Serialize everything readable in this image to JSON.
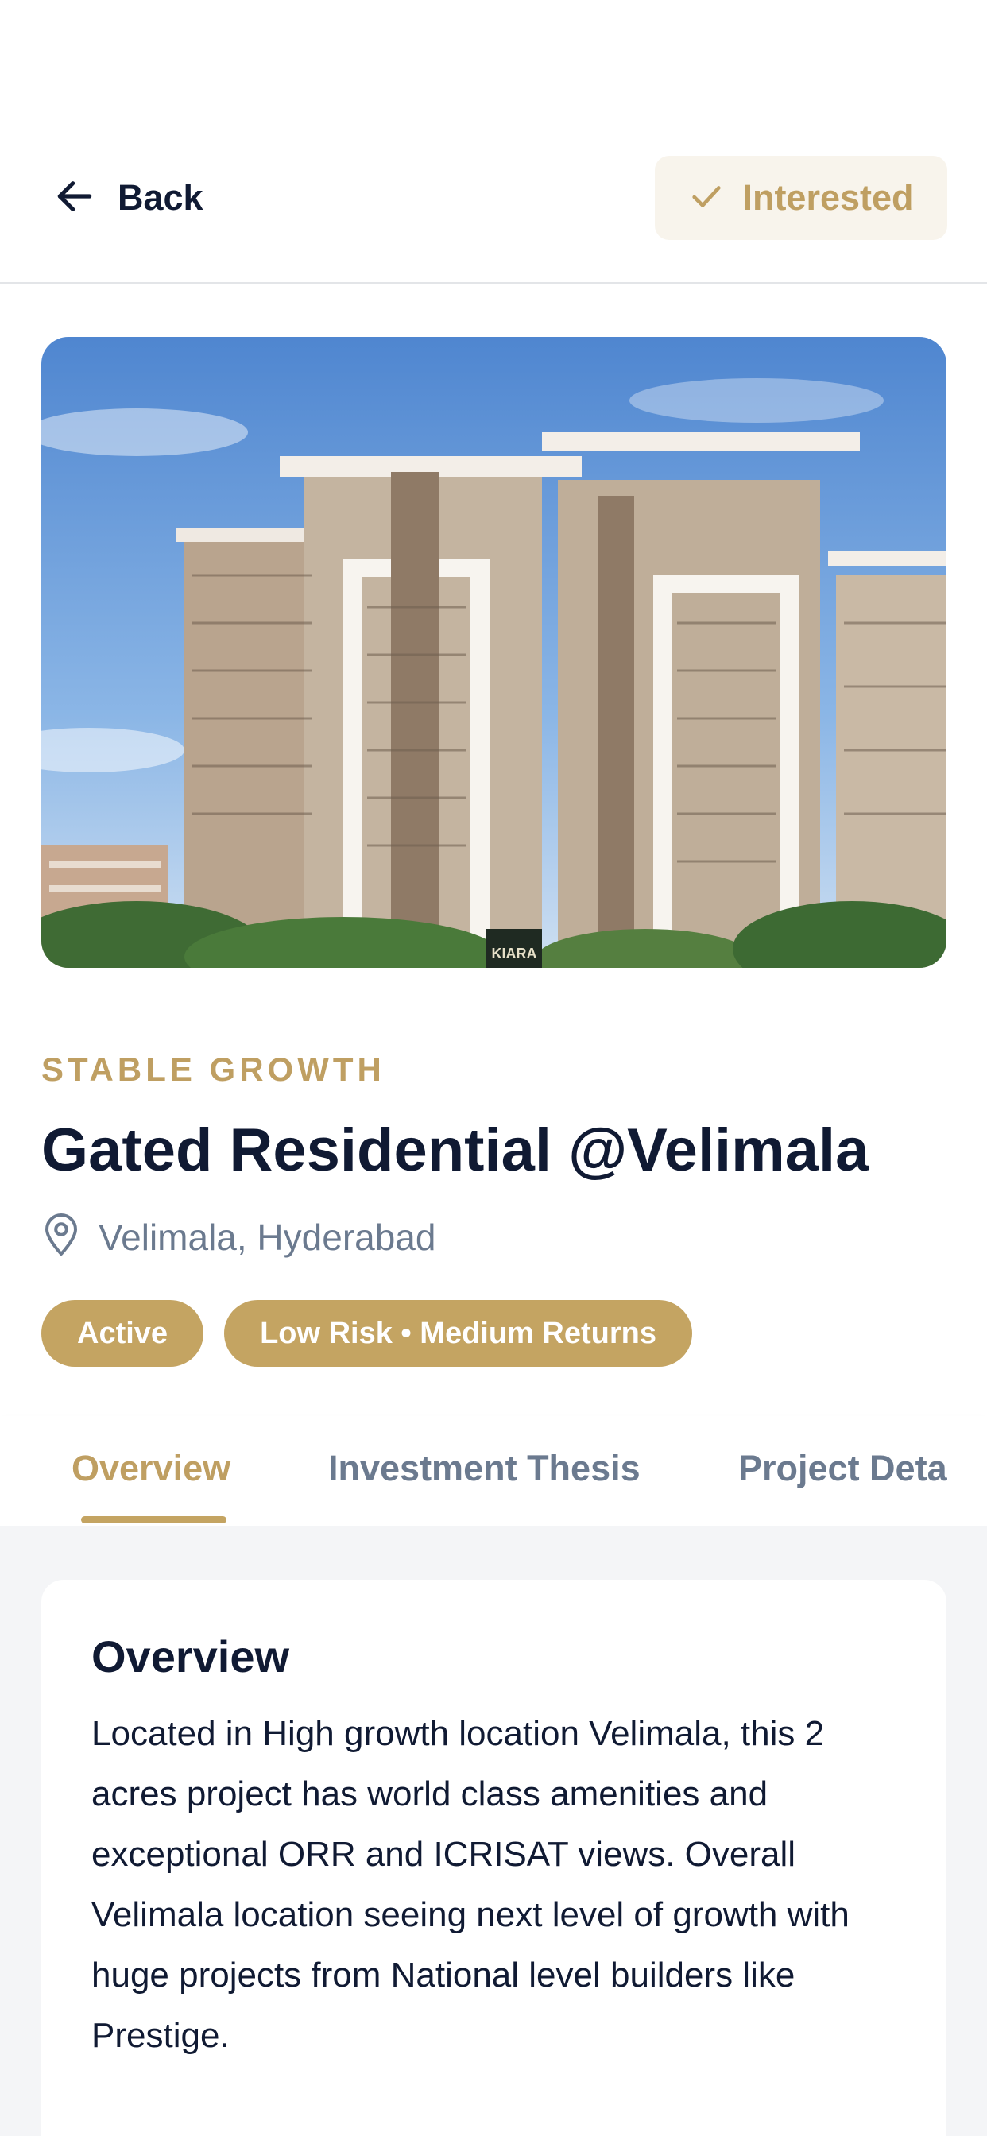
{
  "header": {
    "back_label": "Back",
    "interested_label": "Interested",
    "back_icon": "arrow-left-icon",
    "interested_icon": "check-icon"
  },
  "hero": {
    "image_description_icon": "building-image",
    "sign_text": "KIARA"
  },
  "project": {
    "category": "STABLE GROWTH",
    "title": "Gated Residential @Velimala",
    "location": "Velimala, Hyderabad",
    "location_icon": "map-pin-icon",
    "badges": [
      "Active",
      "Low Risk • Medium Returns"
    ]
  },
  "tabs": [
    {
      "label": "Overview",
      "active": true
    },
    {
      "label": "Investment Thesis",
      "active": false
    },
    {
      "label": "Project Deta",
      "active": false
    }
  ],
  "overview": {
    "title": "Overview",
    "body": "Located in High growth location Velimala, this 2 acres project has world class amenities and exceptional ORR and ICRISAT views. Overall Velimala location seeing next level of growth with huge projects from National level builders like Prestige."
  },
  "colors": {
    "accent": "#c4a462",
    "accent_text": "#bf9f62",
    "primary_text": "#101a33",
    "muted_text": "#6b7a8f",
    "background": "#f4f5f7"
  }
}
